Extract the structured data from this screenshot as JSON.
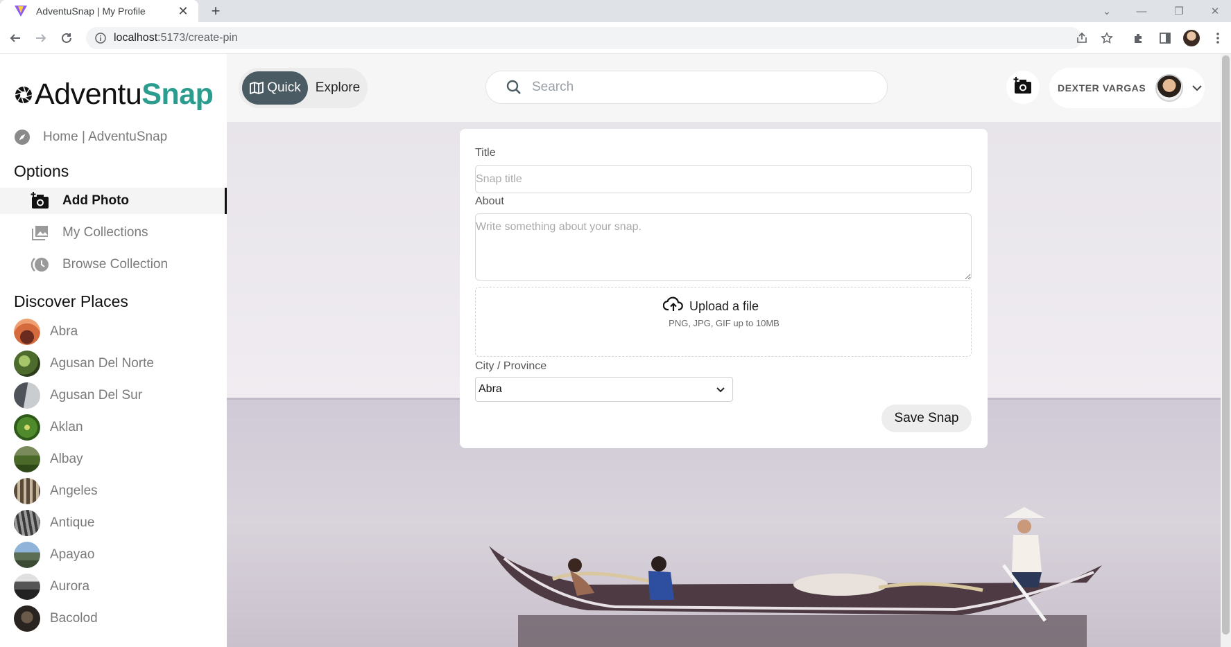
{
  "browser": {
    "tab_title": "AdventuSnap | My Profile",
    "url_host": "localhost",
    "url_rest": ":5173/create-pin"
  },
  "brand": {
    "name_part1": "Adventu",
    "name_part2": "Snap",
    "accent_color": "#2a9d8f"
  },
  "sidebar": {
    "home_label": "Home | AdventuSnap",
    "options_title": "Options",
    "options": [
      {
        "label": "Add Photo",
        "icon": "add-photo-icon",
        "active": true
      },
      {
        "label": "My Collections",
        "icon": "collections-icon",
        "active": false
      },
      {
        "label": "Browse Collection",
        "icon": "browse-icon",
        "active": false
      }
    ],
    "discover_title": "Discover Places",
    "places": [
      {
        "label": "Abra"
      },
      {
        "label": "Agusan Del Norte"
      },
      {
        "label": "Agusan Del Sur"
      },
      {
        "label": "Aklan"
      },
      {
        "label": "Albay"
      },
      {
        "label": "Angeles"
      },
      {
        "label": "Antique"
      },
      {
        "label": "Apayao"
      },
      {
        "label": "Aurora"
      },
      {
        "label": "Bacolod"
      }
    ]
  },
  "header": {
    "mode_quick": "Quick",
    "mode_explore": "Explore",
    "search_placeholder": "Search",
    "user_name": "DEXTER VARGAS"
  },
  "form": {
    "title_label": "Title",
    "title_placeholder": "Snap title",
    "about_label": "About",
    "about_placeholder": "Write something about your snap.",
    "upload_label": "Upload a file",
    "upload_hint": "PNG, JPG, GIF up to 10MB",
    "city_label": "City / Province",
    "city_value": "Abra",
    "save_label": "Save Snap"
  }
}
